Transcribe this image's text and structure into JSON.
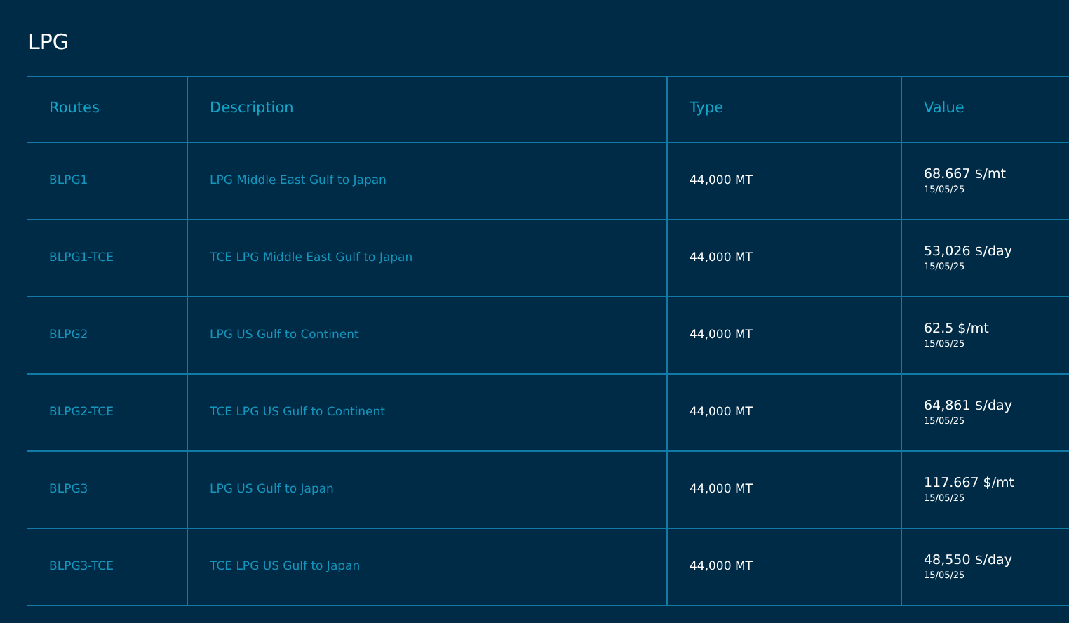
{
  "title": "LPG",
  "table": {
    "columns": [
      "Routes",
      "Description",
      "Type",
      "Value"
    ],
    "rows": [
      {
        "route": "BLPG1",
        "description": "LPG Middle East Gulf to Japan",
        "type": "44,000 MT",
        "value": "68.667 $/mt",
        "date": "15/05/25"
      },
      {
        "route": "BLPG1-TCE",
        "description": "TCE LPG Middle East Gulf to Japan",
        "type": "44,000 MT",
        "value": "53,026 $/day",
        "date": "15/05/25"
      },
      {
        "route": "BLPG2",
        "description": "LPG US Gulf to Continent",
        "type": "44,000 MT",
        "value": "62.5 $/mt",
        "date": "15/05/25"
      },
      {
        "route": "BLPG2-TCE",
        "description": "TCE LPG US Gulf to Continent",
        "type": "44,000 MT",
        "value": "64,861 $/day",
        "date": "15/05/25"
      },
      {
        "route": "BLPG3",
        "description": "LPG US Gulf to Japan",
        "type": "44,000 MT",
        "value": "117.667 $/mt",
        "date": "15/05/25"
      },
      {
        "route": "BLPG3-TCE",
        "description": "TCE LPG US Gulf to Japan",
        "type": "44,000 MT",
        "value": "48,550 $/day",
        "date": "15/05/25"
      }
    ]
  }
}
